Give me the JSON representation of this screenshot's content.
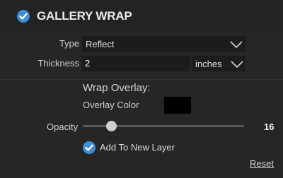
{
  "header": {
    "title": "GALLERY WRAP",
    "enabled": true
  },
  "type": {
    "label": "Type",
    "value": "Reflect"
  },
  "thickness": {
    "label": "Thickness",
    "value": "2",
    "unit": "inches"
  },
  "overlay": {
    "section_title": "Wrap Overlay:",
    "color_label": "Overlay Color",
    "color": "#000000"
  },
  "opacity": {
    "label": "Opacity",
    "value": "16"
  },
  "add_layer": {
    "label": "Add To New Layer",
    "checked": true
  },
  "reset_label": "Reset",
  "colors": {
    "accent": "#3b8fd9",
    "background": "#262626"
  }
}
